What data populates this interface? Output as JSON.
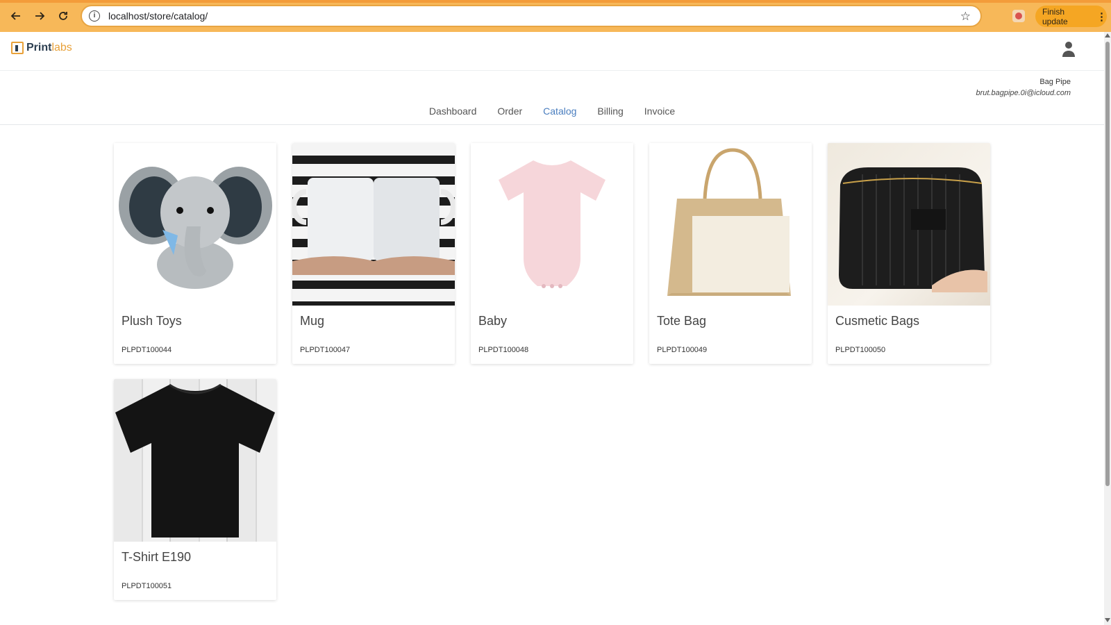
{
  "browser": {
    "url": "localhost/store/catalog/",
    "update_label": "Finish update"
  },
  "brand": {
    "logo_part1": "Print",
    "logo_part2": "labs"
  },
  "account": {
    "name": "Bag Pipe",
    "email": "brut.bagpipe.0i@icloud.com"
  },
  "nav": {
    "tabs": [
      {
        "label": "Dashboard",
        "active": false
      },
      {
        "label": "Order",
        "active": false
      },
      {
        "label": "Catalog",
        "active": true
      },
      {
        "label": "Billing",
        "active": false
      },
      {
        "label": "Invoice",
        "active": false
      }
    ]
  },
  "catalog": {
    "items": [
      {
        "title": "Plush Toys",
        "sku": "PLPDT100044",
        "image": "elephant-plush"
      },
      {
        "title": "Mug",
        "sku": "PLPDT100047",
        "image": "white-mugs"
      },
      {
        "title": "Baby",
        "sku": "PLPDT100048",
        "image": "pink-onesie"
      },
      {
        "title": "Tote Bag",
        "sku": "PLPDT100049",
        "image": "jute-tote"
      },
      {
        "title": "Cusmetic Bags",
        "sku": "PLPDT100050",
        "image": "black-quilted-pouch"
      },
      {
        "title": "T-Shirt E190",
        "sku": "PLPDT100051",
        "image": "black-tshirt"
      }
    ]
  }
}
